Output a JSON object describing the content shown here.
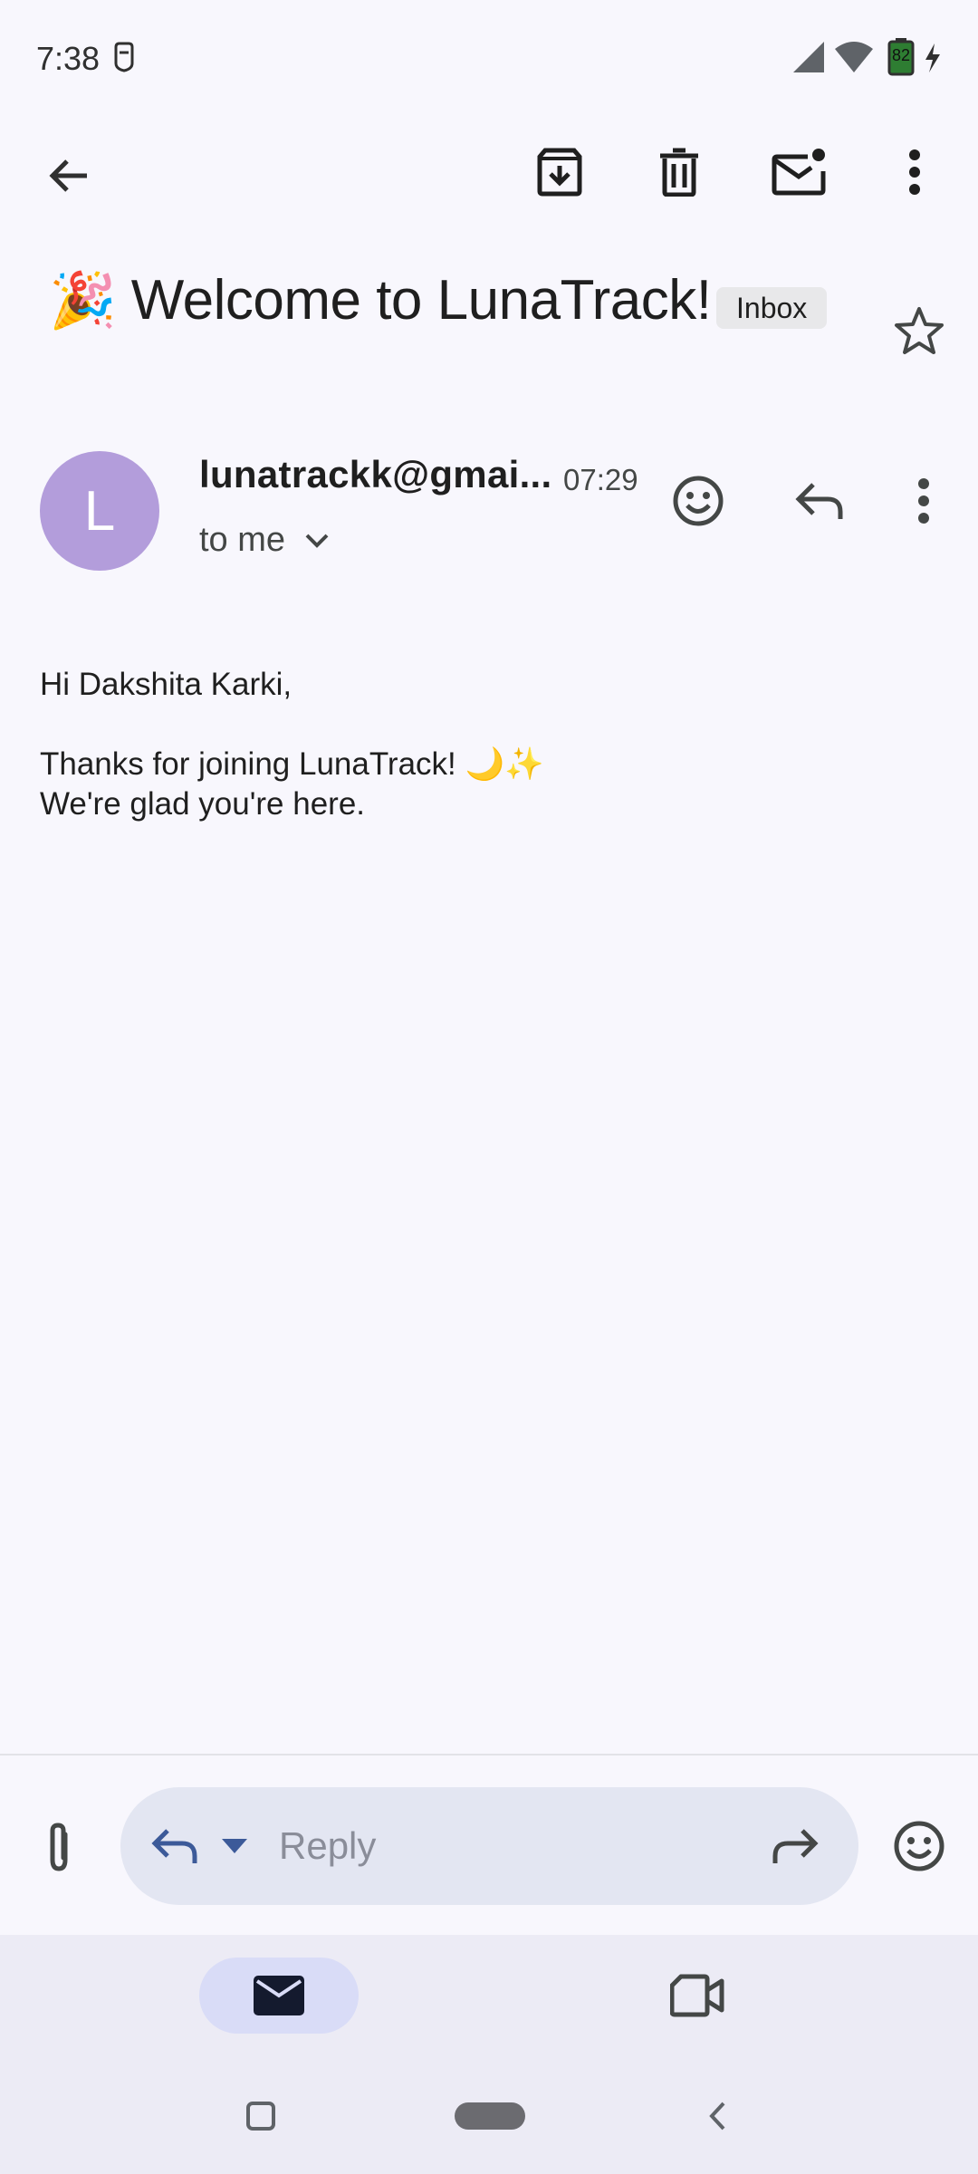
{
  "status_bar": {
    "time": "7:38",
    "battery": "82"
  },
  "toolbar": {
    "back_icon": "arrow-left-icon",
    "archive_icon": "archive-icon",
    "delete_icon": "trash-icon",
    "mark_unread_icon": "mail-unread-icon",
    "more_icon": "more-vert-icon"
  },
  "email": {
    "subject": "Welcome to LunaTrack!",
    "subject_emoji": "🎉",
    "label": "Inbox",
    "sender": "lunatrackk@gmai...",
    "avatar_letter": "L",
    "time": "07:29",
    "recipient": "to me",
    "body": {
      "greeting": "Hi Dakshita Karki,",
      "line1": "Thanks for joining LunaTrack! 🌙✨",
      "line2": "We're glad you're here."
    }
  },
  "reply_bar": {
    "placeholder": "Reply"
  },
  "colors": {
    "background": "#f8f7fd",
    "avatar": "#b39ddb",
    "reply_pill": "#e3e6f2",
    "reply_accent": "#3c5a99",
    "nav_active": "#d9dcf7"
  }
}
